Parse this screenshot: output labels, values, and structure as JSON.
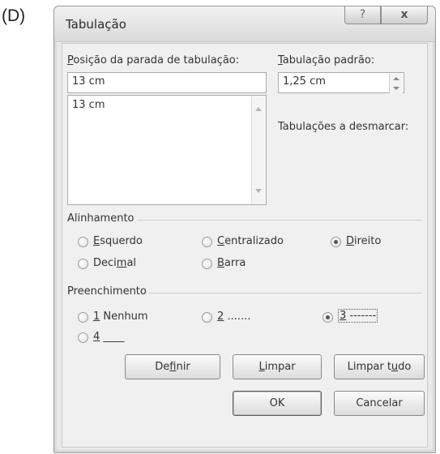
{
  "option_letter": "(D)",
  "dialog": {
    "title": "Tabulação",
    "help_glyph": "?",
    "close_glyph": "x"
  },
  "tab_stop_position": {
    "label_first": "P",
    "label_rest": "osição da parada de tabulação:",
    "value": "13 cm",
    "list_items": [
      "13 cm"
    ]
  },
  "default_tab_stops": {
    "label_first": "T",
    "label_rest": "abulação padrão:",
    "value": "1,25 cm"
  },
  "tabs_to_clear_label": "Tabulações a desmarcar:",
  "alignment": {
    "label": "Alinhamento",
    "options": [
      {
        "first": "E",
        "rest": "squerdo",
        "checked": false
      },
      {
        "first": "C",
        "rest": "entralizado",
        "checked": false
      },
      {
        "first": "D",
        "rest": "ireito",
        "checked": true
      },
      {
        "pre": "Deci",
        "first": "m",
        "rest": "al",
        "checked": false
      },
      {
        "first": "B",
        "rest": "arra",
        "checked": false
      }
    ]
  },
  "leader": {
    "label": "Preenchimento",
    "options": [
      {
        "first": "1",
        "rest": " Nenhum",
        "checked": false
      },
      {
        "first": "2",
        "rest": " .......",
        "checked": false
      },
      {
        "first": "3",
        "rest": " -------",
        "checked": true
      },
      {
        "first": "4",
        "rest": " ____",
        "checked": false
      }
    ]
  },
  "buttons": {
    "set": {
      "pre": "De",
      "first": "f",
      "rest": "inir"
    },
    "clear": {
      "first": "L",
      "rest": "impar"
    },
    "clear_all": {
      "pre": "Limpar t",
      "first": "u",
      "rest": "do"
    },
    "ok": "OK",
    "cancel": "Cancelar"
  }
}
